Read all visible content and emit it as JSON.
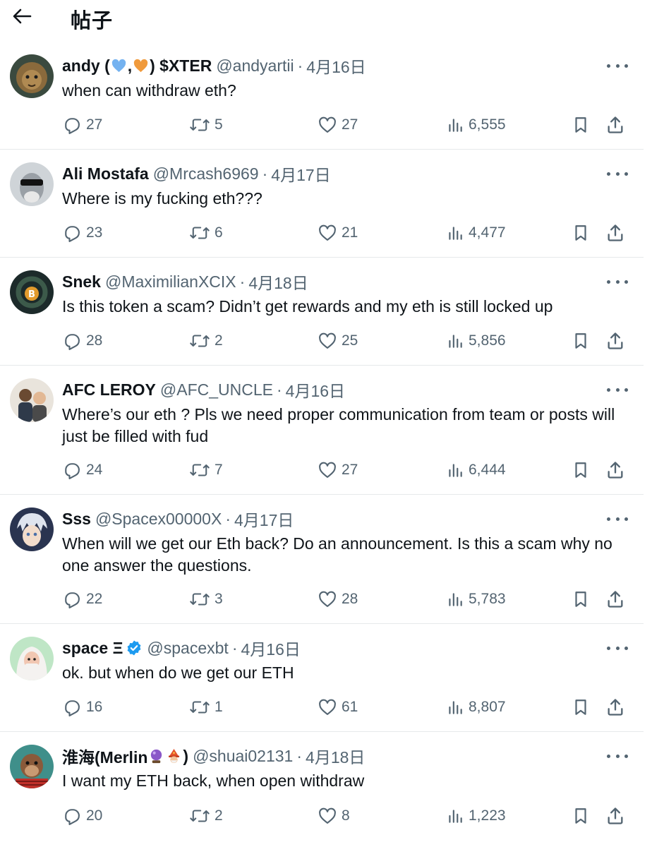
{
  "header": {
    "title": "帖子",
    "back_icon": "arrow-left-icon"
  },
  "posts": [
    {
      "name": "andy (",
      "name_suffix": ",",
      "name_end": ") $XTER",
      "handle": "@andyartii",
      "date": "4月16日",
      "text": "when can withdraw eth?",
      "replies": "27",
      "reposts": "5",
      "likes": "27",
      "views": "6,555",
      "emoji": [
        "blue-heart-emoji",
        "orange-heart-emoji"
      ]
    },
    {
      "name": "Ali Mostafa",
      "handle": "@Mrcash6969",
      "date": "4月17日",
      "text": "Where is my fucking eth???",
      "replies": "23",
      "reposts": "6",
      "likes": "21",
      "views": "4,477"
    },
    {
      "name": "Snek",
      "handle": "@MaximilianXCIX",
      "date": "4月18日",
      "text": "Is this token a scam? Didn’t get rewards and my eth is still locked up",
      "replies": "28",
      "reposts": "2",
      "likes": "25",
      "views": "5,856"
    },
    {
      "name": "AFC LEROY",
      "handle": "@AFC_UNCLE",
      "date": "4月16日",
      "text": "Where’s our eth ? Pls we need proper communication from team or posts will just be filled with fud",
      "replies": "24",
      "reposts": "7",
      "likes": "27",
      "views": "6,444"
    },
    {
      "name": "Sss",
      "handle": "@Spacex00000X",
      "date": "4月17日",
      "text": "When will we get our Eth back? Do an announcement. Is this a scam why no one answer the questions.",
      "replies": "22",
      "reposts": "3",
      "likes": "28",
      "views": "5,783"
    },
    {
      "name": "space Ξ",
      "handle": "@spacexbt",
      "date": "4月16日",
      "text": "ok. but when do we get our ETH",
      "replies": "16",
      "reposts": "1",
      "likes": "61",
      "views": "8,807",
      "verified": true
    },
    {
      "name": "淮海(Merlin",
      "name_end": ")",
      "handle": "@shuai02131",
      "date": "4月18日",
      "text": "I want my ETH back, when open withdraw",
      "replies": "20",
      "reposts": "2",
      "likes": "8",
      "views": "1,223",
      "emoji": [
        "crystal-ball-emoji",
        "mage-emoji"
      ]
    }
  ],
  "separator": "·",
  "colors": {
    "text": "#0f1419",
    "secondary": "#536471",
    "verified": "#1d9bf0",
    "divider": "#e6e9eb"
  },
  "icons": [
    "reply-icon",
    "repost-icon",
    "like-icon",
    "views-icon",
    "bookmark-icon",
    "share-icon",
    "more-icon",
    "verified-badge-icon"
  ]
}
